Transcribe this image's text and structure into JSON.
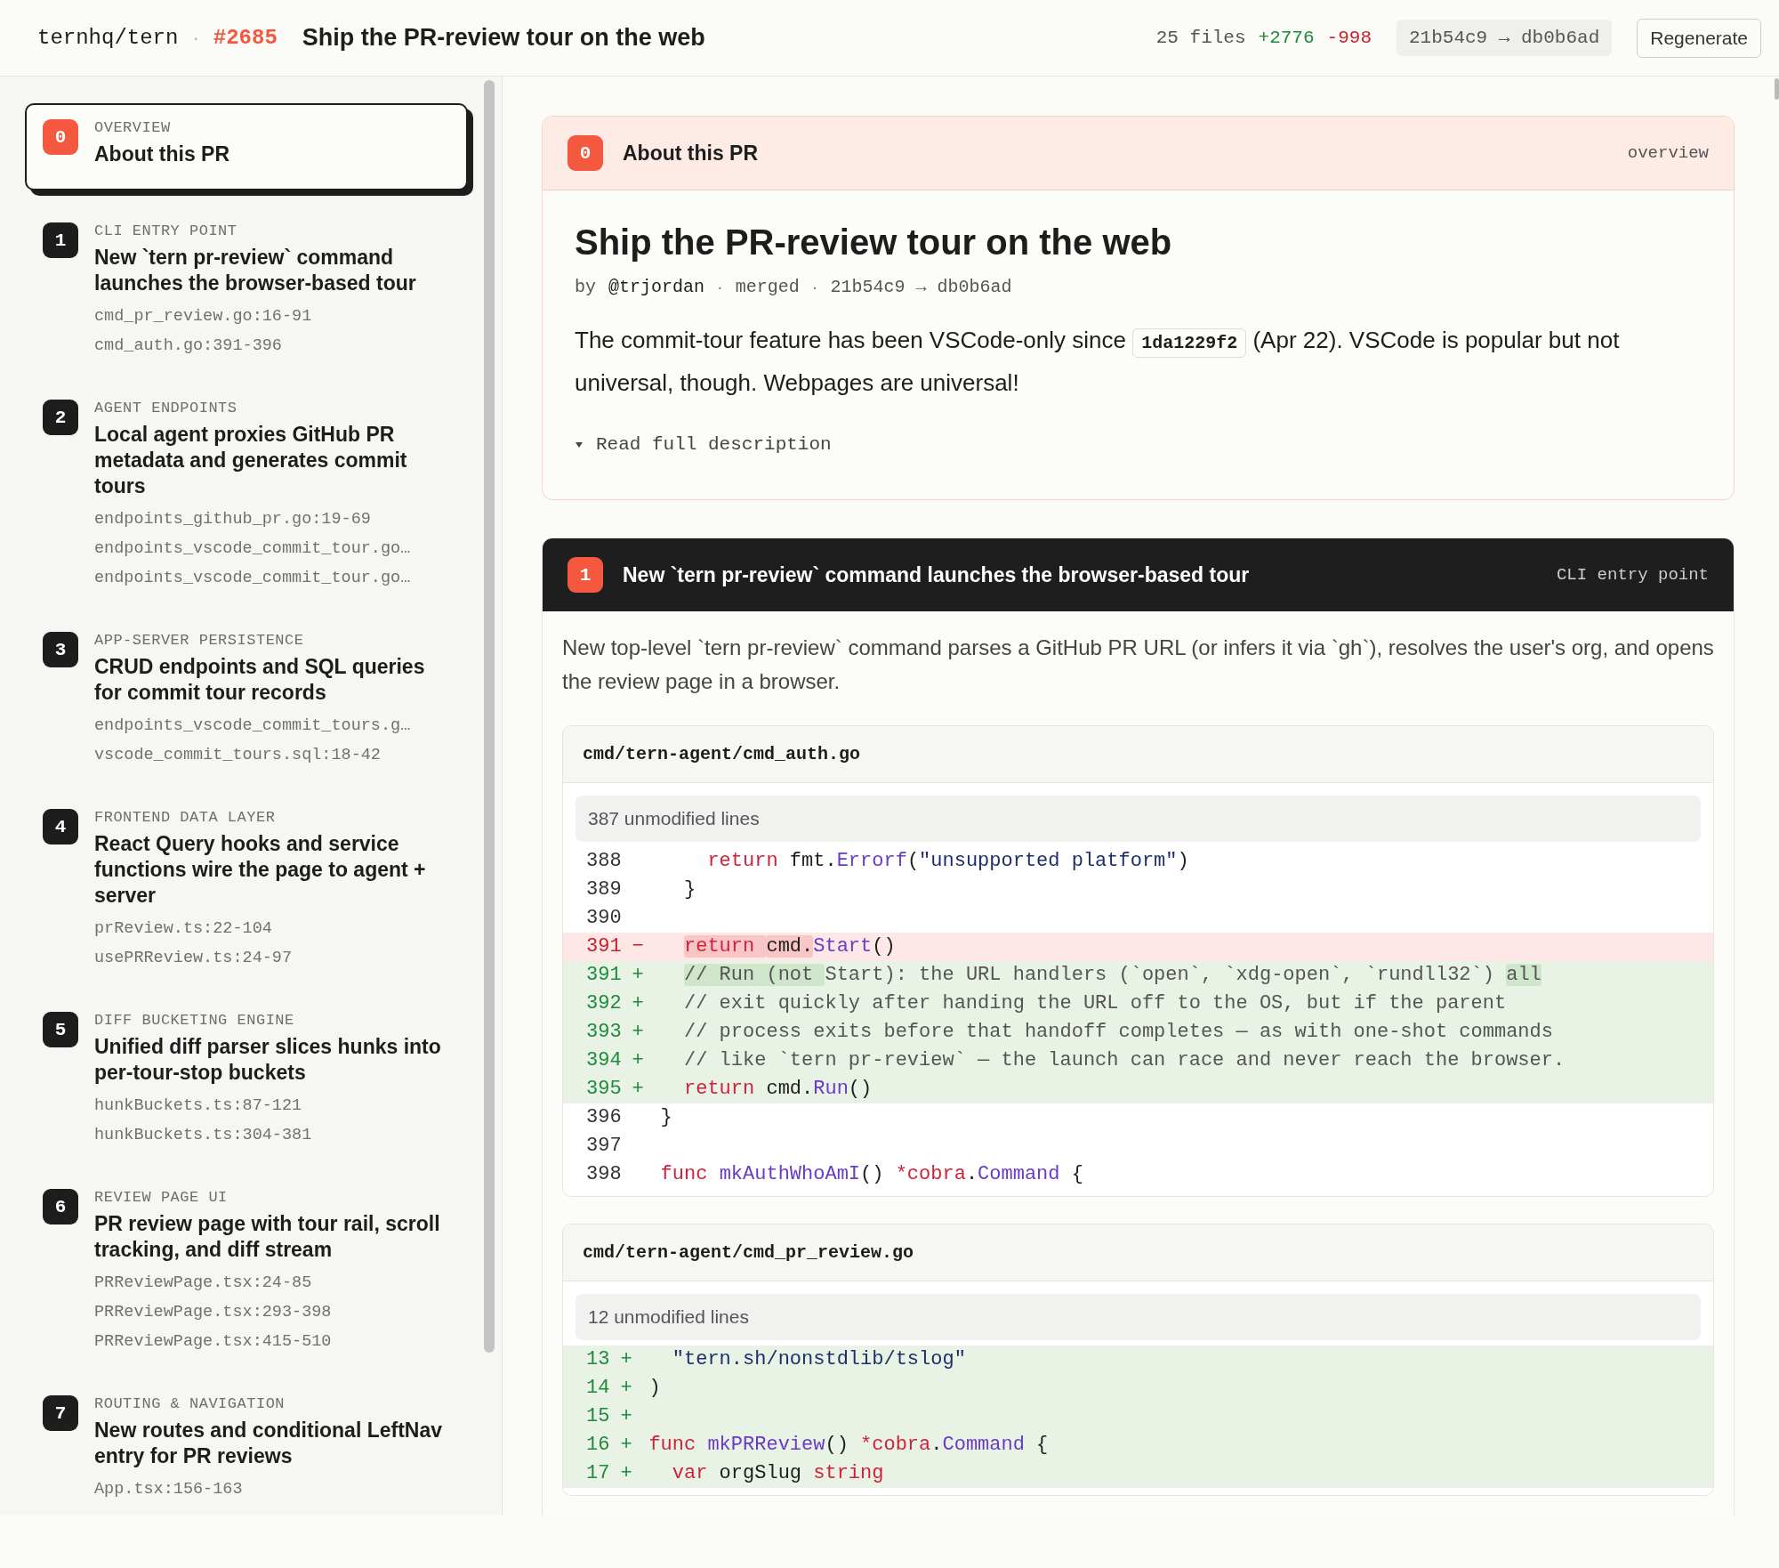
{
  "header": {
    "repo": "ternhq/tern",
    "separator": "·",
    "pr_number": "#2685",
    "title": "Ship the PR-review tour on the web",
    "files": "25 files",
    "additions": "+2776",
    "deletions": "-998",
    "commit_range": "21b54c9 → db0b6ad",
    "regenerate_button": "Regenerate"
  },
  "sidebar": {
    "items": [
      {
        "number": "0",
        "category": "OVERVIEW",
        "title": "About this PR",
        "selected": true
      },
      {
        "number": "1",
        "category": "CLI ENTRY POINT",
        "title": "New `tern pr-review` command launches the browser-based tour",
        "files": [
          "cmd_pr_review.go:16-91",
          "cmd_auth.go:391-396"
        ],
        "selected": false
      },
      {
        "number": "2",
        "category": "AGENT ENDPOINTS",
        "title": "Local agent proxies GitHub PR metadata and generates commit tours",
        "files": [
          "endpoints_github_pr.go:19-69",
          "endpoints_vscode_commit_tour.go…",
          "endpoints_vscode_commit_tour.go…"
        ],
        "selected": false
      },
      {
        "number": "3",
        "category": "APP-SERVER PERSISTENCE",
        "title": "CRUD endpoints and SQL queries for commit tour records",
        "files": [
          "endpoints_vscode_commit_tours.g…",
          "vscode_commit_tours.sql:18-42"
        ],
        "selected": false
      },
      {
        "number": "4",
        "category": "FRONTEND DATA LAYER",
        "title": "React Query hooks and service functions wire the page to agent + server",
        "files": [
          "prReview.ts:22-104",
          "usePRReview.ts:24-97"
        ],
        "selected": false
      },
      {
        "number": "5",
        "category": "DIFF BUCKETING ENGINE",
        "title": "Unified diff parser slices hunks into per-tour-stop buckets",
        "files": [
          "hunkBuckets.ts:87-121",
          "hunkBuckets.ts:304-381"
        ],
        "selected": false
      },
      {
        "number": "6",
        "category": "REVIEW PAGE UI",
        "title": "PR review page with tour rail, scroll tracking, and diff stream",
        "files": [
          "PRReviewPage.tsx:24-85",
          "PRReviewPage.tsx:293-398",
          "PRReviewPage.tsx:415-510"
        ],
        "selected": false
      },
      {
        "number": "7",
        "category": "ROUTING & NAVIGATION",
        "title": "New routes and conditional LeftNav entry for PR reviews",
        "files": [
          "App.tsx:156-163"
        ],
        "selected": false
      }
    ]
  },
  "overview": {
    "number": "0",
    "title": "About this PR",
    "tag": "overview",
    "heading": "Ship the PR-review tour on the web",
    "byline": {
      "prefix": "by",
      "parts": [
        "@trjordan",
        "merged",
        "21b54c9 → db0b6ad"
      ]
    },
    "byline_separator": "·",
    "description": [
      {
        "kind": "text",
        "text": "The commit-tour feature has been VSCode-only since "
      },
      {
        "kind": "code",
        "text": "1da1229f2"
      },
      {
        "kind": "text",
        "text": " (Apr 22). VSCode is popular but not universal, though. Webpages are universal!"
      }
    ],
    "expand_link": "Read full description"
  },
  "stops": [
    {
      "number": "1",
      "title": "New `tern pr-review` command launches the browser-based tour",
      "tag": "CLI entry point",
      "summary": "New top-level `tern pr-review` command parses a GitHub PR URL (or infers it via `gh`), resolves the user's org, and opens the review page in a browser.",
      "files": [
        {
          "path": "cmd/tern-agent/cmd_auth.go",
          "collapsed": "387 unmodified lines",
          "lines": [
            {
              "number": "388",
              "kind": "context",
              "tokens": [
                {
                  "kind": "keyword",
                  "text": "    return"
                },
                {
                  "kind": "plain",
                  "text": " fmt."
                },
                {
                  "kind": "function",
                  "text": "Errorf"
                },
                {
                  "kind": "plain",
                  "text": "("
                },
                {
                  "kind": "string",
                  "text": "\"unsupported platform\""
                },
                {
                  "kind": "plain",
                  "text": ")"
                }
              ]
            },
            {
              "number": "389",
              "kind": "context",
              "tokens": [
                {
                  "kind": "plain",
                  "text": "  }"
                }
              ]
            },
            {
              "number": "390",
              "kind": "context"
            },
            {
              "number": "391",
              "kind": "removed",
              "sign": "−",
              "tokens": [
                {
                  "kind": "keyword",
                  "text": "  return ",
                  "highlight": true
                },
                {
                  "kind": "plain",
                  "text": "cmd.",
                  "highlight": true
                },
                {
                  "kind": "function",
                  "text": "Start"
                },
                {
                  "kind": "plain",
                  "text": "()"
                }
              ]
            },
            {
              "number": "391",
              "kind": "added",
              "sign": "+",
              "tokens": [
                {
                  "kind": "comment",
                  "text": "  // Run (not ",
                  "highlight": true
                },
                {
                  "kind": "comment",
                  "text": "Start): the URL handlers (`open`, `xdg-open`, `rundll32`)"
                },
                {
                  "kind": "comment",
                  "text": " all",
                  "highlight": true
                }
              ]
            },
            {
              "number": "392",
              "kind": "added",
              "sign": "+",
              "tokens": [
                {
                  "kind": "comment",
                  "text": "  // exit quickly after handing the URL off to the OS, but if the parent"
                }
              ]
            },
            {
              "number": "393",
              "kind": "added",
              "sign": "+",
              "tokens": [
                {
                  "kind": "comment",
                  "text": "  // process exits before that handoff completes — as with one-shot commands"
                }
              ]
            },
            {
              "number": "394",
              "kind": "added",
              "sign": "+",
              "tokens": [
                {
                  "kind": "comment",
                  "text": "  // like `tern pr-review` — the launch can race and never reach the browser."
                }
              ]
            },
            {
              "number": "395",
              "kind": "added",
              "sign": "+",
              "tokens": [
                {
                  "kind": "keyword",
                  "text": "  return"
                },
                {
                  "kind": "plain",
                  "text": " cmd."
                },
                {
                  "kind": "function",
                  "text": "Run"
                },
                {
                  "kind": "plain",
                  "text": "()"
                }
              ]
            },
            {
              "number": "396",
              "kind": "context",
              "tokens": [
                {
                  "kind": "plain",
                  "text": "}"
                }
              ]
            },
            {
              "number": "397",
              "kind": "context"
            },
            {
              "number": "398",
              "kind": "context",
              "tokens": [
                {
                  "kind": "keyword",
                  "text": "func "
                },
                {
                  "kind": "function",
                  "text": "mkAuthWhoAmI"
                },
                {
                  "kind": "plain",
                  "text": "() "
                },
                {
                  "kind": "keyword",
                  "text": "*cobra"
                },
                {
                  "kind": "plain",
                  "text": "."
                },
                {
                  "kind": "function",
                  "text": "Command"
                },
                {
                  "kind": "plain",
                  "text": " {"
                }
              ]
            }
          ]
        },
        {
          "path": "cmd/tern-agent/cmd_pr_review.go",
          "collapsed": "12 unmodified lines",
          "lines": [
            {
              "number": "13",
              "kind": "added",
              "sign": "+",
              "tokens": [
                {
                  "kind": "string",
                  "text": "  \"tern.sh/nonstdlib/tslog\""
                }
              ]
            },
            {
              "number": "14",
              "kind": "added",
              "sign": "+",
              "tokens": [
                {
                  "kind": "plain",
                  "text": ")"
                }
              ]
            },
            {
              "number": "15",
              "kind": "added",
              "sign": "+"
            },
            {
              "number": "16",
              "kind": "added",
              "sign": "+",
              "tokens": [
                {
                  "kind": "keyword",
                  "text": "func "
                },
                {
                  "kind": "function",
                  "text": "mkPRReview"
                },
                {
                  "kind": "plain",
                  "text": "() "
                },
                {
                  "kind": "keyword",
                  "text": "*cobra"
                },
                {
                  "kind": "plain",
                  "text": "."
                },
                {
                  "kind": "function",
                  "text": "Command"
                },
                {
                  "kind": "plain",
                  "text": " {"
                }
              ]
            },
            {
              "number": "17",
              "kind": "added",
              "sign": "+",
              "tokens": [
                {
                  "kind": "keyword",
                  "text": "  var"
                },
                {
                  "kind": "plain",
                  "text": " orgSlug "
                },
                {
                  "kind": "keyword",
                  "text": "string"
                }
              ]
            }
          ]
        }
      ]
    }
  ]
}
